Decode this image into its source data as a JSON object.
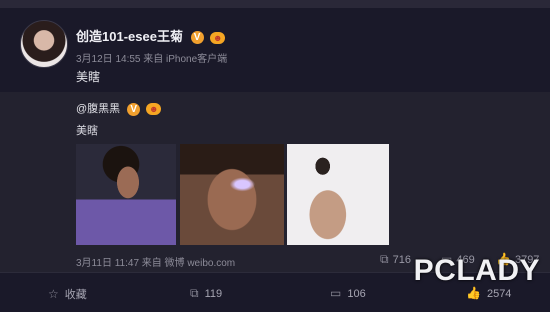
{
  "post": {
    "author": "创造101-esee王菊",
    "verified_badge": "V",
    "vip_badge": "☻",
    "meta": "3月12日 14:55 来自 iPhone客户端",
    "text": "美瞎"
  },
  "repost": {
    "author": "@腹黑黑",
    "verified_badge": "V",
    "vip_badge": "☻",
    "text": "美瞎",
    "meta": "3月11日 11:47 来自 微博 weibo.com",
    "reposts": "716",
    "comments": "469",
    "likes": "3797"
  },
  "actions": {
    "favorite": "收藏",
    "repost_count": "119",
    "comment_count": "106",
    "like_count": "2574"
  },
  "watermark": "PCLADY"
}
